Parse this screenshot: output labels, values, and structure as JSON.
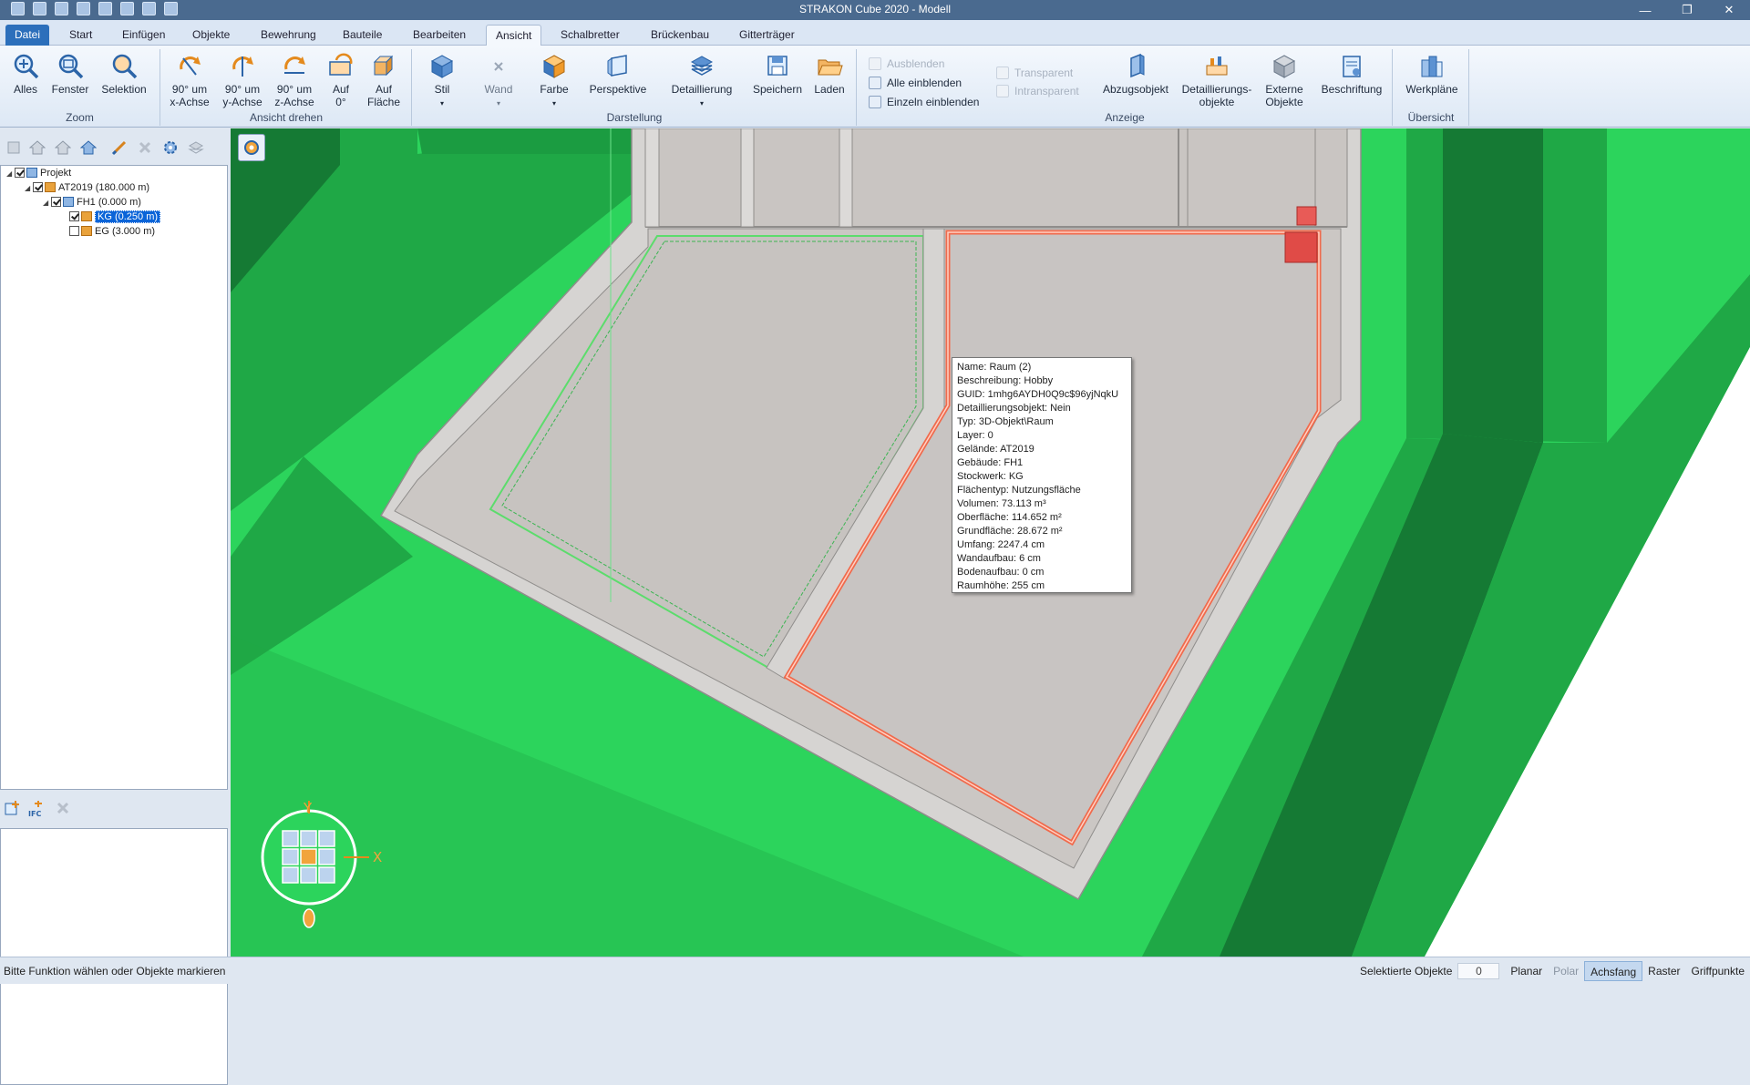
{
  "window": {
    "title": "STRAKON Cube 2020 - Modell",
    "controls": [
      "—",
      "❐",
      "✕"
    ]
  },
  "menu": {
    "tabs": [
      "Datei",
      "Start",
      "Einfügen",
      "Objekte",
      "Bewehrung",
      "Bauteile",
      "Bearbeiten",
      "Ansicht",
      "Schalbretter",
      "Brückenbau",
      "Gitterträger"
    ],
    "active": "Ansicht"
  },
  "ribbon": {
    "zoom": {
      "label": "Zoom",
      "alles": "Alles",
      "fenster": "Fenster",
      "selektion": "Selektion"
    },
    "drehen": {
      "label": "Ansicht drehen",
      "x1": "90° um",
      "x2": "x-Achse",
      "y1": "90° um",
      "y2": "y-Achse",
      "z1": "90° um",
      "z2": "z-Achse",
      "a1": "Auf",
      "a2": "0°",
      "f1": "Auf",
      "f2": "Fläche"
    },
    "darstellung": {
      "label": "Darstellung",
      "stil": "Stil",
      "wand": "Wand",
      "farbe": "Farbe",
      "perspektive": "Perspektive",
      "detaillierung": "Detaillierung",
      "speichern": "Speichern",
      "laden": "Laden"
    },
    "anzeige": {
      "label": "Anzeige",
      "ausblenden": "Ausblenden",
      "alle_einblenden": "Alle einblenden",
      "einzeln_einblenden": "Einzeln einblenden",
      "transparent": "Transparent",
      "intransparent": "Intransparent",
      "abzugsobjekt": "Abzugsobjekt",
      "det1": "Detaillierungs-",
      "det2": "objekte",
      "ext1": "Externe",
      "ext2": "Objekte",
      "beschriftung": "Beschriftung"
    },
    "uebersicht": {
      "label": "Übersicht",
      "werkplaene": "Werkpläne"
    }
  },
  "tree": {
    "projekt": "Projekt",
    "gelaende": "AT2019 (180.000 m)",
    "gebaeude": "FH1 (0.000 m)",
    "kg": "KG (0.250 m)",
    "eg": "EG (3.000 m)"
  },
  "tooltip": {
    "name": "Name: Raum (2)",
    "beschreibung": "Beschreibung: Hobby",
    "guid": "GUID: 1mhg6AYDH0Q9c$96yjNqkU",
    "detaillierungsobjekt": "Detaillierungsobjekt: Nein",
    "typ": "Typ: 3D-Objekt\\Raum",
    "layer": "Layer: 0",
    "gelaende": "Gelände: AT2019",
    "gebaeude": "Gebäude: FH1",
    "stockwerk": "Stockwerk: KG",
    "flaechentyp": "Flächentyp: Nutzungsfläche",
    "volumen": "Volumen: 73.113 m³",
    "oberflaeche": "Oberfläche: 114.652 m²",
    "grundflaeche": "Grundfläche: 28.672 m²",
    "umfang": "Umfang: 2247.4 cm",
    "wandaufbau": "Wandaufbau: 6 cm",
    "bodenaufbau": "Bodenaufbau: 0 cm",
    "raumhoehe": "Raumhöhe: 255 cm"
  },
  "axes": {
    "y": "Y",
    "x": "X"
  },
  "status": {
    "prompt": "Bitte Funktion wählen oder Objekte markieren",
    "selektierte_label": "Selektierte Objekte",
    "selektierte_count": "0",
    "planar": "Planar",
    "polar": "Polar",
    "achsfang": "Achsfang",
    "raster": "Raster",
    "griffpunkte": "Griffpunkte"
  },
  "colors": {
    "terrain_light": "#2cd45c",
    "terrain_mid": "#1fa846",
    "terrain_dark": "#157a34",
    "floor": "#c9c5c2",
    "wall": "#d6d4d2",
    "room_selected": "#f06a4c",
    "room_green": "#5cdc6c"
  }
}
